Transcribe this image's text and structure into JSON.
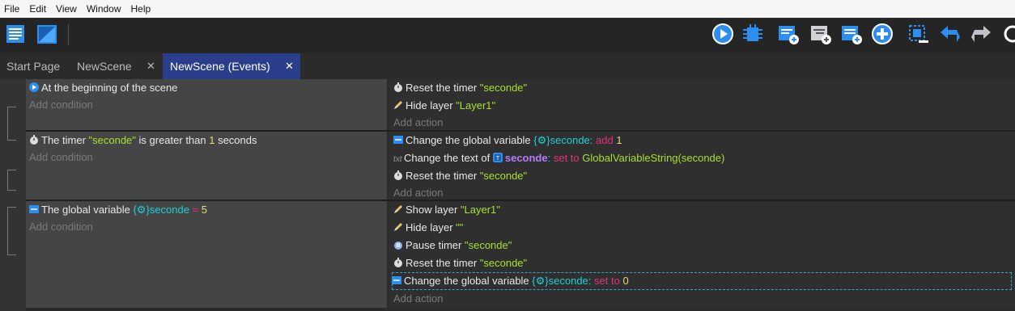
{
  "menu": [
    "File",
    "Edit",
    "View",
    "Window",
    "Help"
  ],
  "toolbar": {
    "left_icons": [
      "project-manager-icon",
      "scene-editor-icon"
    ],
    "right_icons": [
      "preview-icon",
      "debugger-icon",
      "add-event-icon",
      "add-sub-event-icon",
      "add-comment-icon",
      "add-new-icon",
      "select-icon",
      "undo-icon",
      "redo-icon",
      "search-icon"
    ]
  },
  "tabs": [
    {
      "label": "Start Page",
      "closable": false,
      "active": false
    },
    {
      "label": "NewScene",
      "closable": true,
      "active": false
    },
    {
      "label": "NewScene (Events)",
      "closable": true,
      "active": true
    }
  ],
  "close_glyph": "✕",
  "placeholders": {
    "add_condition": "Add condition",
    "add_action": "Add action"
  },
  "events": [
    {
      "conditions": [
        {
          "text": "At the beginning of the scene"
        }
      ],
      "actions": [
        {
          "prefix": "Reset the timer ",
          "str": "\"seconde\""
        },
        {
          "prefix": "Hide layer ",
          "str": "\"Layer1\""
        }
      ]
    },
    {
      "conditions": [
        {
          "t1": "The timer ",
          "str": "\"seconde\"",
          "t2": " is greater than ",
          "num": "1",
          "t3": " seconds"
        }
      ],
      "actions": [
        {
          "prefix": "Change the global variable ",
          "var": "seconde",
          "colon": ":",
          "op": " add ",
          "num": "1"
        },
        {
          "prefix": "Change the text of ",
          "obj": "seconde",
          "colon": ":",
          "op": " set to ",
          "str": "GlobalVariableString(seconde)"
        },
        {
          "prefix": "Reset the timer ",
          "str": "\"seconde\""
        }
      ]
    },
    {
      "conditions": [
        {
          "t1": "The global variable ",
          "var": "seconde",
          "op": " = ",
          "num": "5"
        }
      ],
      "actions": [
        {
          "prefix": "Show layer ",
          "str": "\"Layer1\""
        },
        {
          "prefix": "Hide layer ",
          "str": "\"\""
        },
        {
          "prefix": "Pause timer ",
          "str": "\"seconde\""
        },
        {
          "prefix": "Reset the timer ",
          "str": "\"seconde\""
        },
        {
          "prefix": "Change the global variable ",
          "var": "seconde",
          "colon": ":",
          "op": " set to ",
          "num": "0"
        }
      ]
    }
  ],
  "colors": {
    "string": "#a6e22e",
    "number": "#e6db74",
    "variable": "#1fd0d8",
    "operator": "#e0337a",
    "object": "#b77bff",
    "active_tab": "#2b3e8c"
  }
}
